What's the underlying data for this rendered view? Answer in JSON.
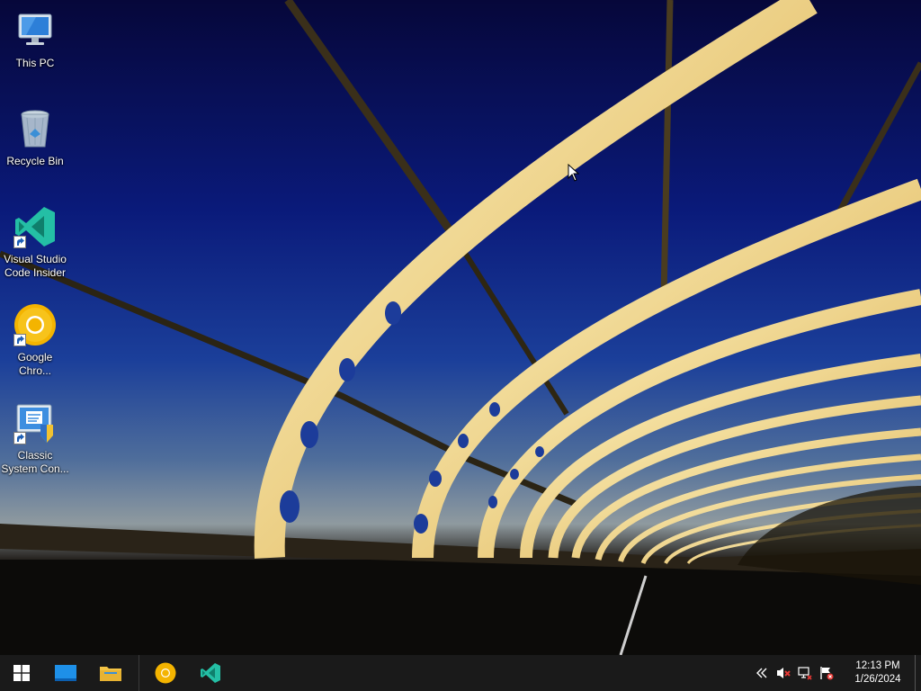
{
  "desktop": {
    "icons": [
      {
        "label": "This PC",
        "icon": "this-pc-icon"
      },
      {
        "label": "Recycle Bin",
        "icon": "recycle-bin-icon"
      },
      {
        "label": "Visual Studio Code Insider",
        "icon": "vscode-insiders-icon",
        "shortcut": true
      },
      {
        "label": "Google Chro...",
        "icon": "google-chrome-icon",
        "shortcut": true
      },
      {
        "label": "Classic System Con...",
        "icon": "control-panel-icon",
        "shortcut": true
      }
    ]
  },
  "taskbar": {
    "start": {
      "icon": "windows-start-icon"
    },
    "pinned": [
      {
        "name": "task-view",
        "icon": "desktop-icon"
      },
      {
        "name": "file-explorer",
        "icon": "folder-icon"
      },
      {
        "name": "google-chrome",
        "icon": "google-chrome-icon"
      },
      {
        "name": "vscode-insiders",
        "icon": "vscode-insiders-icon"
      }
    ],
    "tray": {
      "icons": [
        "chevron-left-icon",
        "volume-muted-icon",
        "network-disconnected-icon",
        "action-center-flag-icon"
      ],
      "time": "12:13 PM",
      "date": "1/26/2024"
    }
  },
  "colors": {
    "taskbar_bg": "#1a1a1a",
    "vscode_insiders": "#24bfa5",
    "chrome_yellow": "#f7c31b",
    "folder_yellow": "#f4c445"
  }
}
